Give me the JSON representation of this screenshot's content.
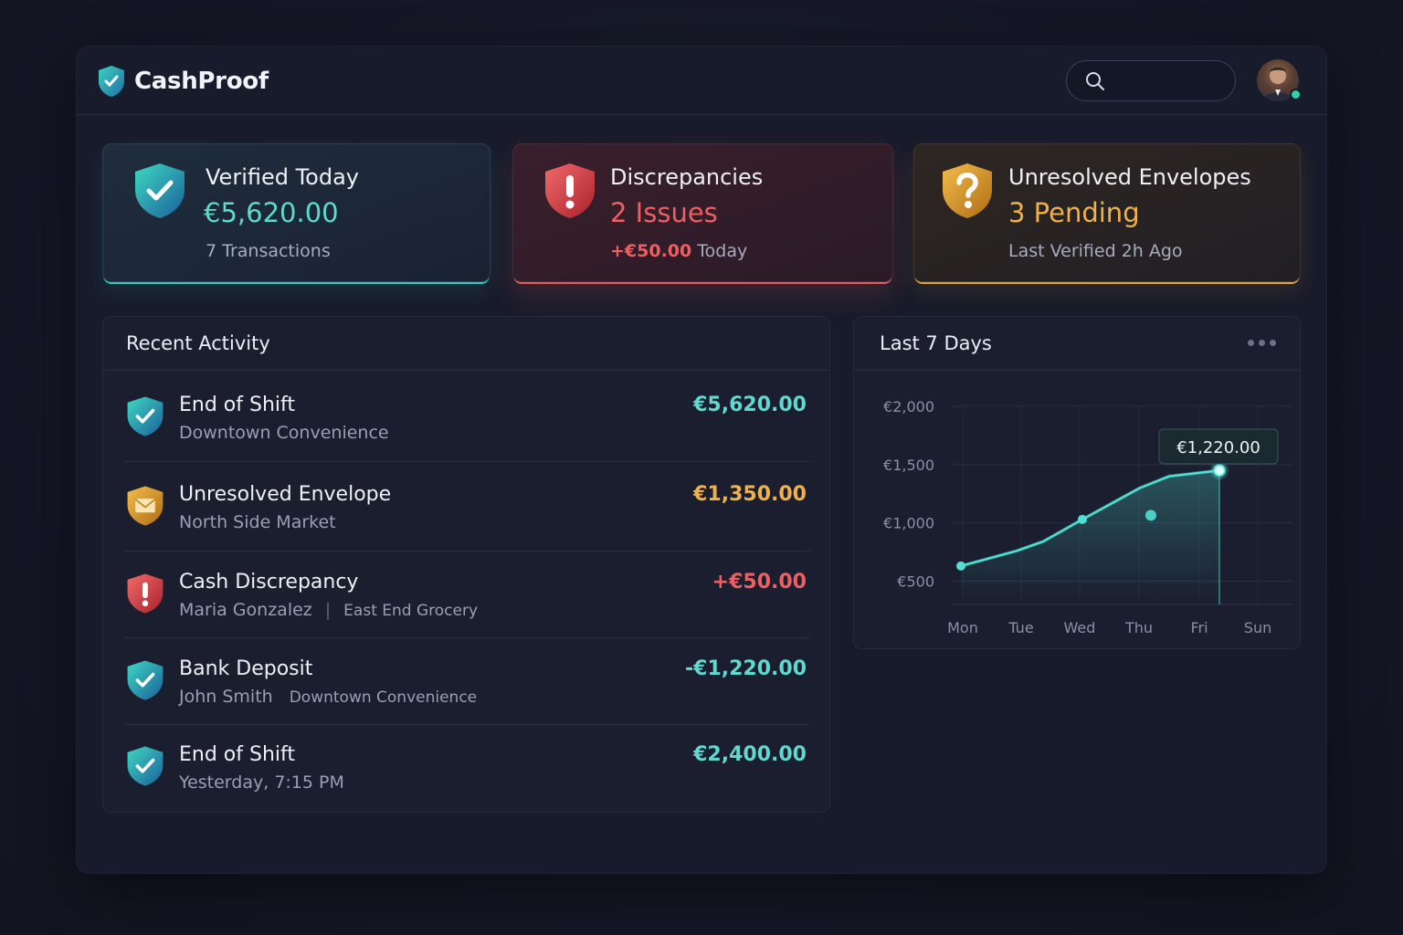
{
  "app": {
    "name": "CashProof"
  },
  "header": {
    "search_placeholder": ""
  },
  "cards": [
    {
      "title": "Verified Today",
      "value": "€5,620.00",
      "sub": "7 Transactions",
      "icon": "shield-check-icon",
      "color": "#35c9c0"
    },
    {
      "title": "Discrepancies",
      "value": "2 Issues",
      "sub_amount": "+€50.00",
      "sub_suffix": " Today",
      "icon": "shield-alert-icon",
      "color": "#e65b5b"
    },
    {
      "title": "Unresolved Envelopes",
      "value": "3 Pending",
      "sub": "Last Verified 2h Ago",
      "icon": "shield-question-icon",
      "color": "#e0a63a"
    }
  ],
  "activity": {
    "title": "Recent Activity",
    "rows": [
      {
        "title": "End of Shift",
        "sub": "Downtown Convenience",
        "extra": "",
        "amount": "€5,620.00",
        "type": "verified"
      },
      {
        "title": "Unresolved Envelope",
        "sub": "North Side Market",
        "extra": "",
        "amount": "€1,350.00",
        "type": "envelope"
      },
      {
        "title": "Cash Discrepancy",
        "sub": "Maria Gonzalez",
        "extra": "East End Grocery",
        "amount": "+€50.00",
        "type": "alert"
      },
      {
        "title": "Bank Deposit",
        "sub": "John Smith",
        "extra": "Downtown Convenience",
        "amount": "-€1,220.00",
        "type": "verified"
      },
      {
        "title": "End of Shift",
        "sub": "Yesterday, 7:15 PM",
        "extra": "",
        "amount": "€2,400.00",
        "type": "verified"
      }
    ]
  },
  "chart_panel": {
    "title": "Last 7 Days",
    "tooltip": "€1,220.00"
  },
  "chart_data": {
    "type": "line",
    "title": "Last 7 Days",
    "categories": [
      "Mon",
      "Tue",
      "Wed",
      "Thu",
      "Fri",
      "Sun"
    ],
    "y_ticks": [
      "€2,000",
      "€1,500",
      "€1,000",
      "€500"
    ],
    "ylim": [
      300,
      2000
    ],
    "points": [
      {
        "x": "Mon",
        "y": 630
      },
      {
        "x": "Tue",
        "y": 760
      },
      {
        "x": "Tue-Wed",
        "y": 840
      },
      {
        "x": "Wed",
        "y": 1030
      },
      {
        "x": "Thu",
        "y": 1300
      },
      {
        "x": "Thu-Fri",
        "y": 1400
      },
      {
        "x": "Fri",
        "y": 1450
      }
    ],
    "highlight": {
      "x": "Fri",
      "y": 1450,
      "label": "€1,220.00"
    },
    "color": "#4fe0d4",
    "grid": true
  }
}
